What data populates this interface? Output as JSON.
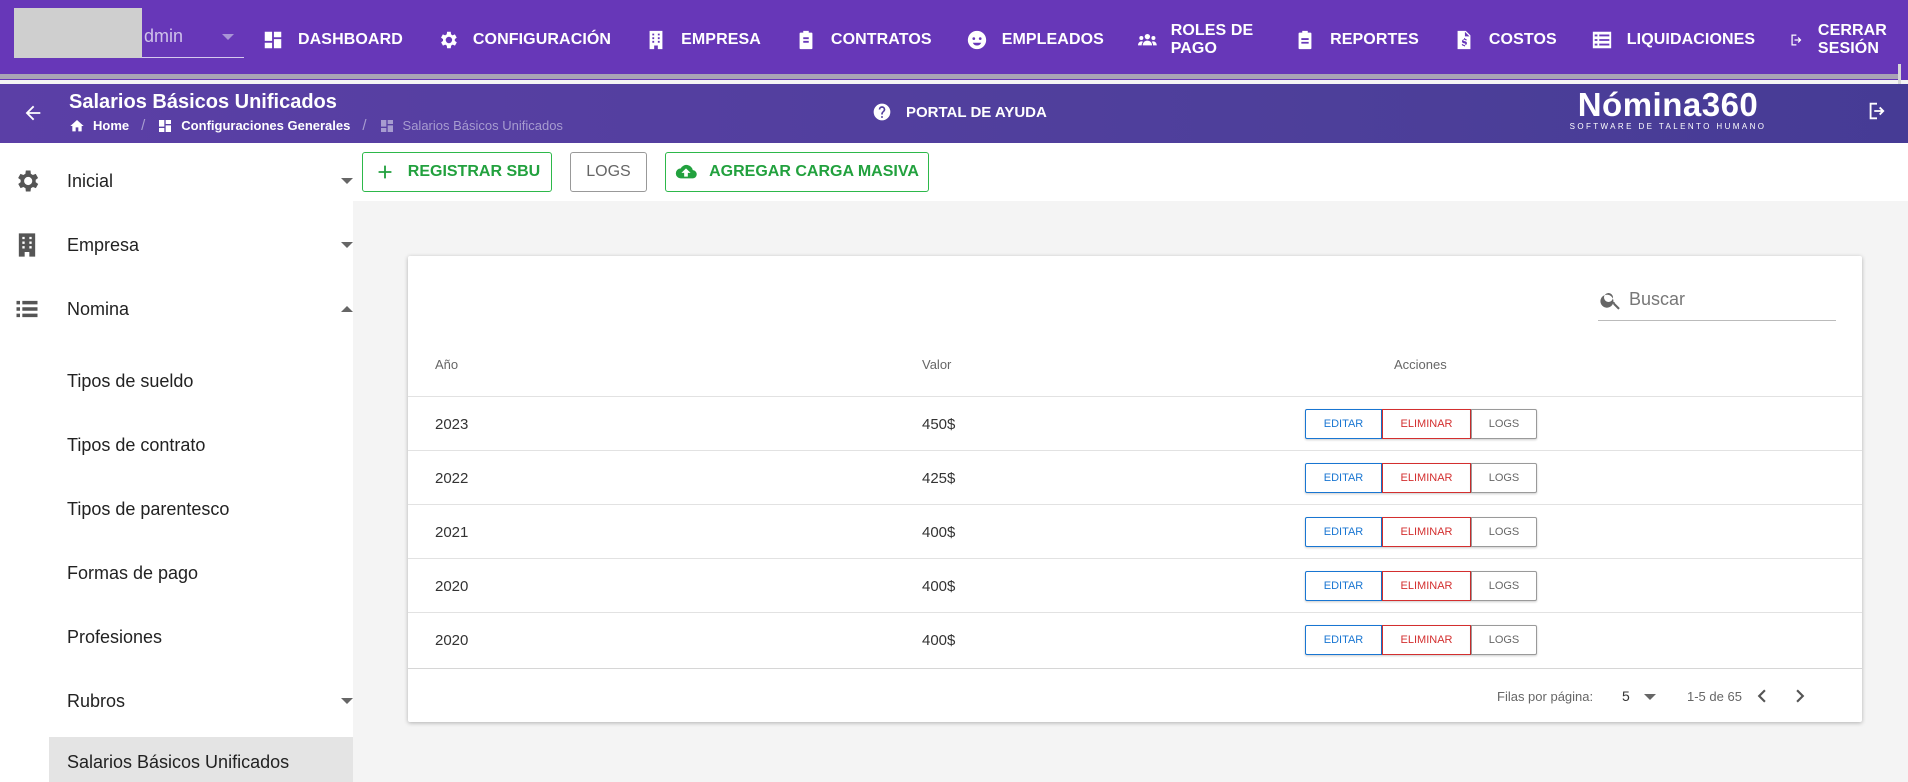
{
  "topbar": {
    "user_text": "dmin",
    "nav": [
      {
        "label": "DASHBOARD",
        "icon": "dashboard-icon"
      },
      {
        "label": "CONFIGURACIÓN",
        "icon": "gear-icon"
      },
      {
        "label": "EMPRESA",
        "icon": "building-icon"
      },
      {
        "label": "CONTRATOS",
        "icon": "clipboard-icon"
      },
      {
        "label": "EMPLEADOS",
        "icon": "face-icon"
      },
      {
        "label": "ROLES DE PAGO",
        "icon": "users-icon"
      },
      {
        "label": "REPORTES",
        "icon": "clipboard-list-icon"
      },
      {
        "label": "COSTOS",
        "icon": "invoice-dollar-icon"
      },
      {
        "label": "LIQUIDACIONES",
        "icon": "list-icon"
      },
      {
        "label": "CERRAR SESIÓN",
        "icon": "logout-icon"
      }
    ]
  },
  "header": {
    "title": "Salarios Básicos Unificados",
    "breadcrumb": [
      "Home",
      "Configuraciones Generales",
      "Salarios Básicos Unificados"
    ],
    "help": "PORTAL DE AYUDA",
    "brand_name": "Nómina360",
    "brand_tagline": "SOFTWARE DE TALENTO HUMANO"
  },
  "sidebar": {
    "groups": [
      {
        "label": "Inicial",
        "icon": "gear-icon",
        "expanded": false
      },
      {
        "label": "Empresa",
        "icon": "building-icon",
        "expanded": false
      },
      {
        "label": "Nomina",
        "icon": "list-icon",
        "expanded": true
      }
    ],
    "items": [
      "Tipos de sueldo",
      "Tipos de contrato",
      "Tipos de parentesco",
      "Formas de pago",
      "Profesiones",
      "Rubros",
      "Salarios Básicos Unificados"
    ]
  },
  "toolbar": {
    "register": "REGISTRAR SBU",
    "logs": "LOGS",
    "bulk": "AGREGAR CARGA MASIVA"
  },
  "table": {
    "search_placeholder": "Buscar",
    "columns": [
      "Año",
      "Valor",
      "Acciones"
    ],
    "rows": [
      {
        "year": "2023",
        "value": "450$"
      },
      {
        "year": "2022",
        "value": "425$"
      },
      {
        "year": "2021",
        "value": "400$"
      },
      {
        "year": "2020",
        "value": "400$"
      },
      {
        "year": "2020",
        "value": "400$"
      }
    ],
    "actions": {
      "edit": "EDITAR",
      "delete": "ELIMINAR",
      "logs": "LOGS"
    },
    "rows_per_page_label": "Filas por página:",
    "rows_per_page": "5",
    "range": "1-5 de 65"
  },
  "colors": {
    "topbar": "#6737b8",
    "header": "#4d3f9a",
    "green": "#22a13e",
    "edit": "#1976d2",
    "delete": "#d32f2f"
  }
}
